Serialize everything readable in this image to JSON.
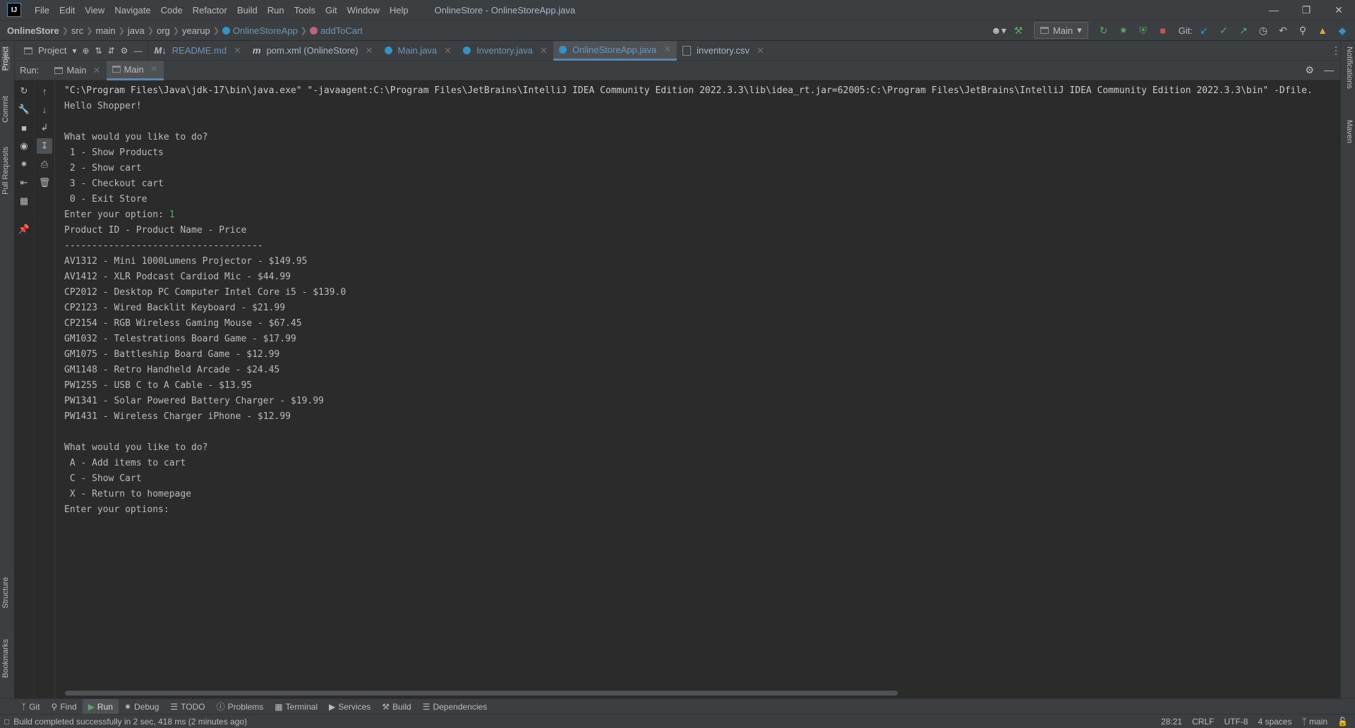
{
  "menu": {
    "items": [
      "File",
      "Edit",
      "View",
      "Navigate",
      "Code",
      "Refactor",
      "Build",
      "Run",
      "Tools",
      "Git",
      "Window",
      "Help"
    ],
    "window_title": "OnlineStore - OnlineStoreApp.java",
    "logo_text": "IJ"
  },
  "breadcrumb": {
    "project": "OnlineStore",
    "parts": [
      "src",
      "main",
      "java",
      "org",
      "yearup"
    ],
    "class": "OnlineStoreApp",
    "method": "addToCart"
  },
  "toolbar": {
    "run_config": "Main",
    "git_label": "Git:"
  },
  "project_tool": {
    "label": "Project"
  },
  "editor_tabs": [
    {
      "label": "README.md"
    },
    {
      "label": "pom.xml (OnlineStore)"
    },
    {
      "label": "Main.java"
    },
    {
      "label": "Inventory.java"
    },
    {
      "label": "OnlineStoreApp.java"
    },
    {
      "label": "inventory.csv"
    }
  ],
  "run_panel": {
    "label": "Run:",
    "tabs": [
      "Main",
      "Main"
    ]
  },
  "left_strip": [
    "Project",
    "Commit",
    "Pull Requests",
    "Structure",
    "Bookmarks"
  ],
  "right_strip": [
    "Notifications",
    "Maven"
  ],
  "console": {
    "lines": [
      "\"C:\\Program Files\\Java\\jdk-17\\bin\\java.exe\" \"-javaagent:C:\\Program Files\\JetBrains\\IntelliJ IDEA Community Edition 2022.3.3\\lib\\idea_rt.jar=62005:C:\\Program Files\\JetBrains\\IntelliJ IDEA Community Edition 2022.3.3\\bin\" -Dfile.",
      "Hello Shopper!",
      "",
      "What would you like to do?",
      " 1 - Show Products",
      " 2 - Show cart",
      " 3 - Checkout cart",
      " 0 - Exit Store",
      "Enter your option: ",
      "Product ID - Product Name - Price",
      "------------------------------------",
      "AV1312 - Mini 1000Lumens Projector - $149.95",
      "AV1412 - XLR Podcast Cardiod Mic - $44.99",
      "CP2012 - Desktop PC Computer Intel Core i5 - $139.0",
      "CP2123 - Wired Backlit Keyboard - $21.99",
      "CP2154 - RGB Wireless Gaming Mouse - $67.45",
      "GM1032 - Telestrations Board Game - $17.99",
      "GM1075 - Battleship Board Game - $12.99",
      "GM1148 - Retro Handheld Arcade - $24.45",
      "PW1255 - USB C to A Cable - $13.95",
      "PW1341 - Solar Powered Battery Charger - $19.99",
      "PW1431 - Wireless Charger iPhone - $12.99",
      "",
      "What would you like to do?",
      " A - Add items to cart",
      " C - Show Cart",
      " X - Return to homepage",
      "Enter your options: "
    ],
    "user_input": "1"
  },
  "bottom_tools": [
    "Git",
    "Find",
    "Run",
    "Debug",
    "TODO",
    "Problems",
    "Terminal",
    "Services",
    "Build",
    "Dependencies"
  ],
  "status": {
    "message": "Build completed successfully in 2 sec, 418 ms (2 minutes ago)",
    "position": "28:21",
    "line_sep": "CRLF",
    "encoding": "UTF-8",
    "indent": "4 spaces",
    "branch": "main"
  }
}
